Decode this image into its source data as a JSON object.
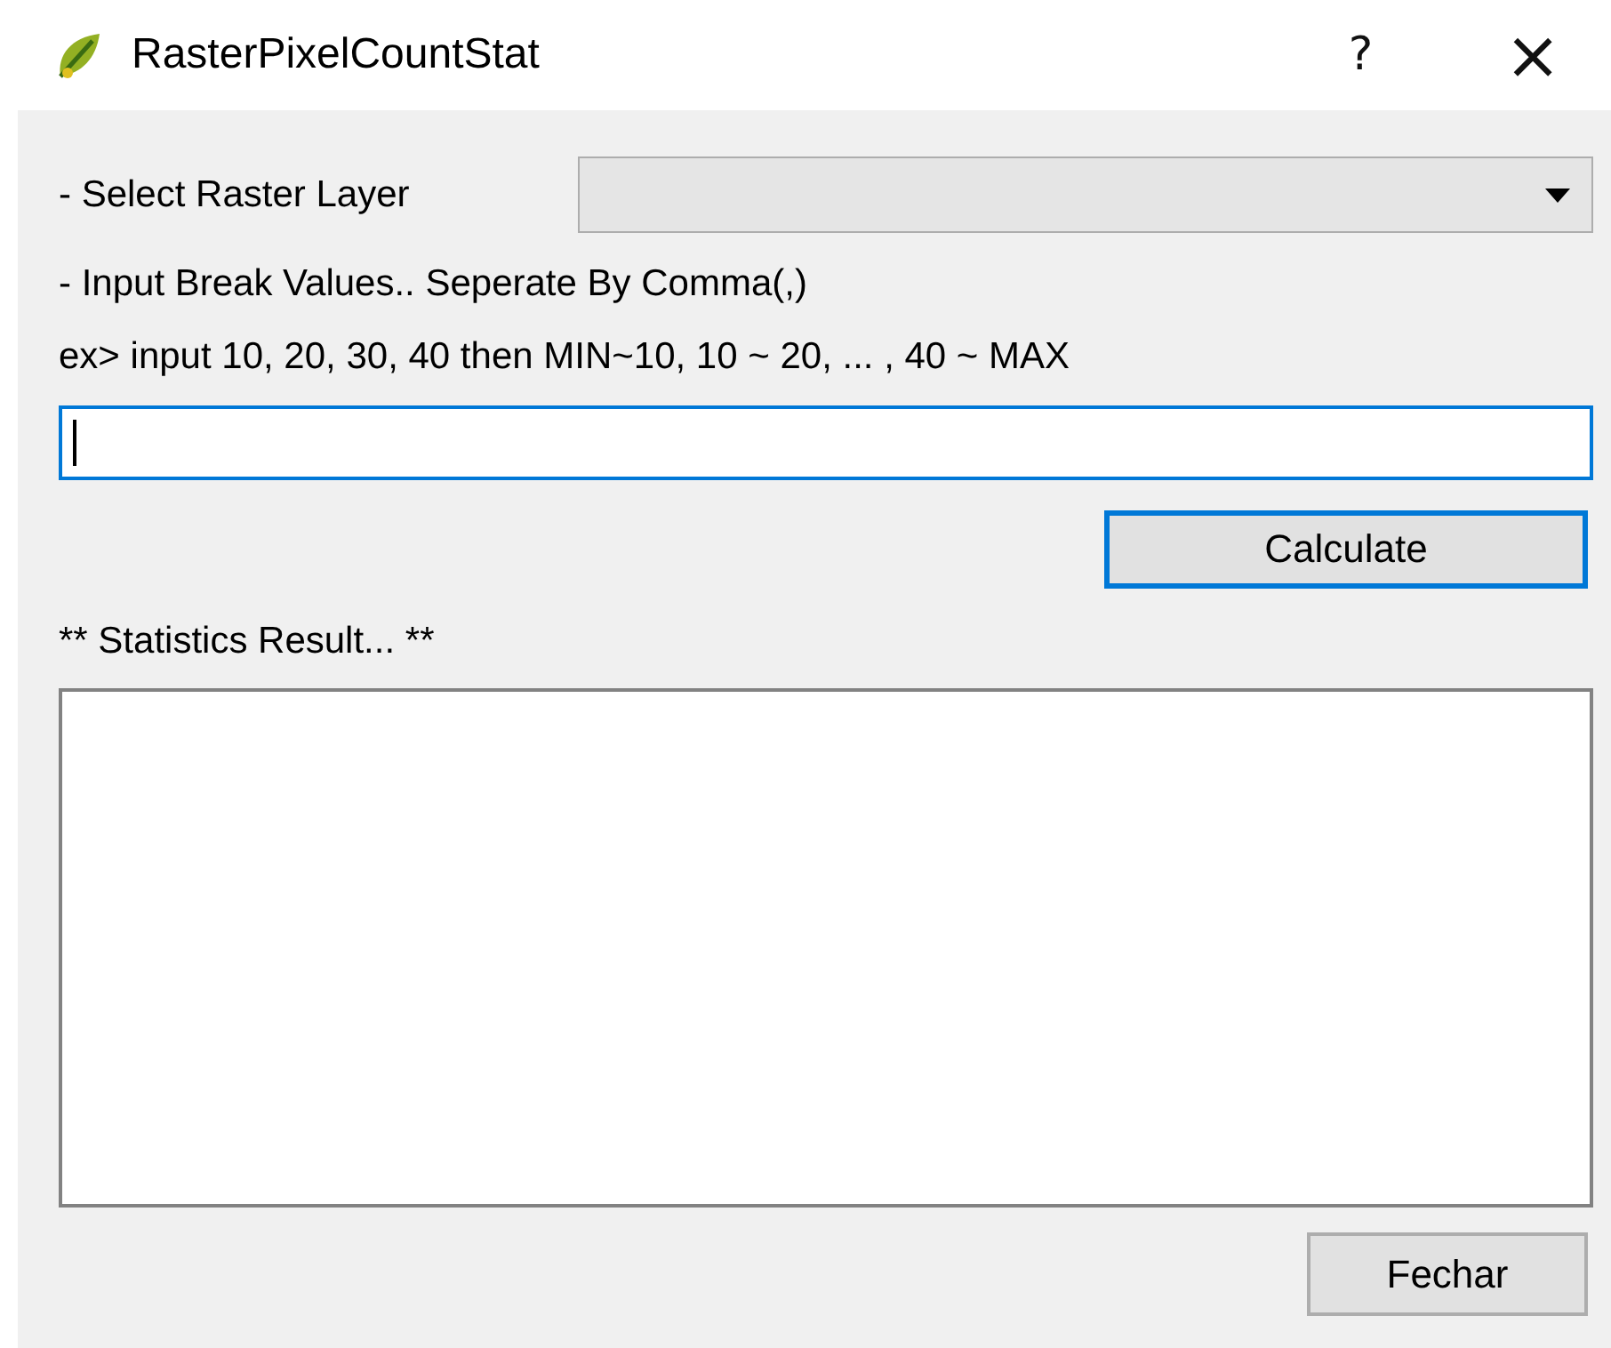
{
  "window": {
    "title": "RasterPixelCountStat",
    "help": "?",
    "close": "×"
  },
  "layer_label": "- Select Raster Layer",
  "break_label": "- Input Break Values.. Seperate By Comma(,)",
  "example": "ex> input 10, 20, 30, 40 then MIN~10, 10 ~ 20, ... , 40 ~ MAX",
  "break_input": {
    "focused": true
  },
  "calculate_button": {
    "label": "Calculate",
    "default": true
  },
  "result_label": "** Statistics Result... **",
  "result_box": {
    "focused": false
  },
  "close_button": {
    "label": "Fechar",
    "default": false
  }
}
